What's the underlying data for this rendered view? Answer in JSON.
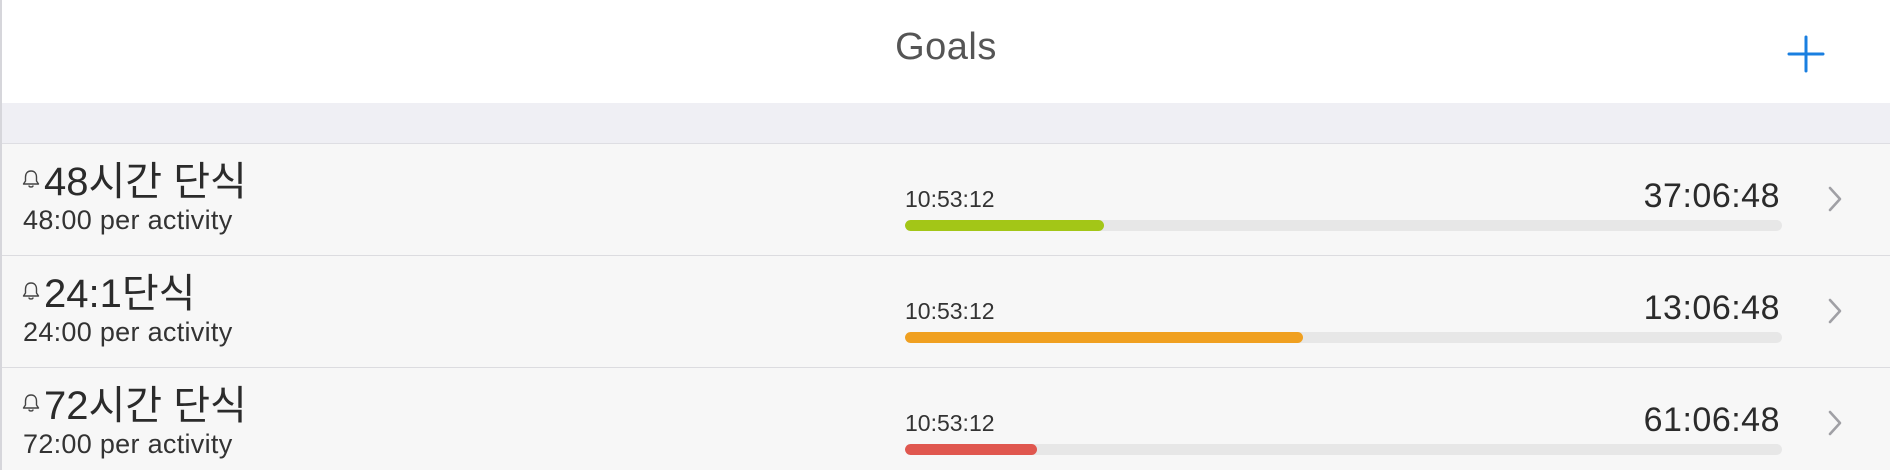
{
  "header": {
    "title": "Goals",
    "add_icon": "plus-icon",
    "accent": "#1a7fe0"
  },
  "goals": [
    {
      "name": "48시간 단식",
      "subtitle": "48:00 per activity",
      "elapsed": "10:53:12",
      "remaining": "37:06:48",
      "progress": 0.227,
      "color": "#a3c617",
      "reminder_icon": "bell-icon"
    },
    {
      "name": "24:1단식",
      "subtitle": "24:00 per activity",
      "elapsed": "10:53:12",
      "remaining": "13:06:48",
      "progress": 0.454,
      "color": "#f0a020",
      "reminder_icon": "bell-icon"
    },
    {
      "name": "72시간 단식",
      "subtitle": "72:00 per activity",
      "elapsed": "10:53:12",
      "remaining": "61:06:48",
      "progress": 0.151,
      "color": "#e0574f",
      "reminder_icon": "bell-icon"
    }
  ]
}
